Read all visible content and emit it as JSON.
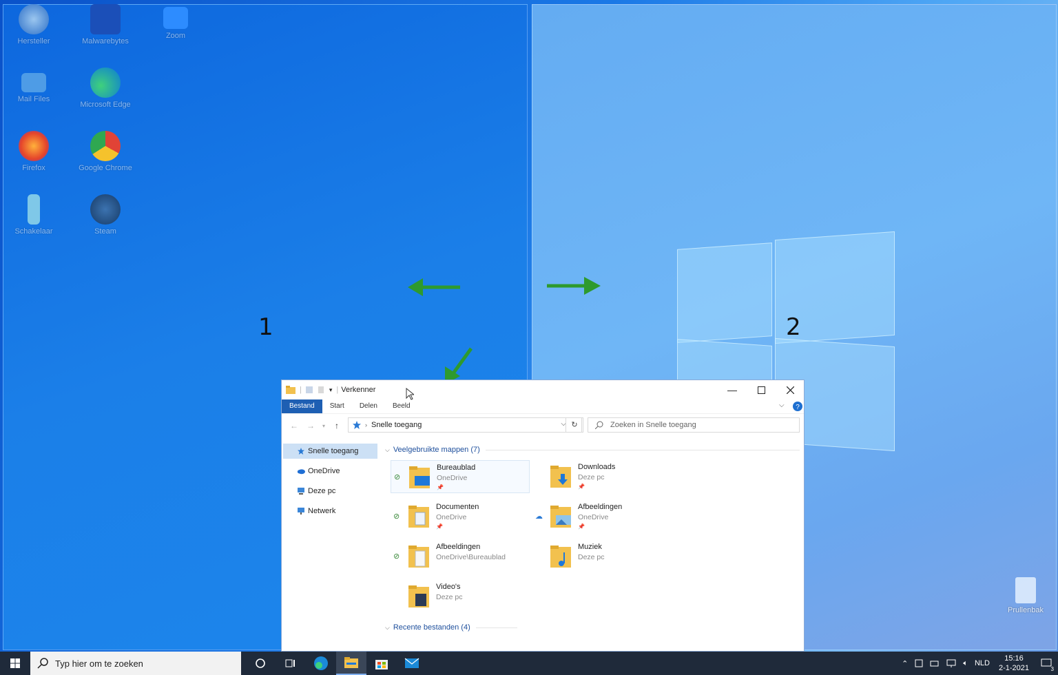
{
  "desktop": {
    "icons": [
      {
        "label": "Hersteller",
        "icon": "recovery-icon"
      },
      {
        "label": "Malwarebytes",
        "icon": "malwarebytes-icon"
      },
      {
        "label": "Zoom",
        "icon": "zoom-icon"
      },
      {
        "label": "Mail Files",
        "icon": "mail-files-icon"
      },
      {
        "label": "Microsoft Edge",
        "icon": "edge-icon"
      },
      {
        "label": "Firefox",
        "icon": "firefox-icon"
      },
      {
        "label": "Google Chrome",
        "icon": "chrome-icon"
      },
      {
        "label": "Schakelaar",
        "icon": "app-icon"
      },
      {
        "label": "Steam",
        "icon": "steam-icon"
      }
    ],
    "recycle_bin": "Prullenbak",
    "snap_labels": {
      "left": "1",
      "right": "2"
    },
    "colors": {
      "arrow": "#2e9a2e"
    }
  },
  "explorer": {
    "title": "Verkenner",
    "ribbon_tabs": [
      "Bestand",
      "Start",
      "Delen",
      "Beeld"
    ],
    "address": "Snelle toegang",
    "search_placeholder": "Zoeken in Snelle toegang",
    "sidebar": [
      "Snelle toegang",
      "OneDrive",
      "Deze pc",
      "Netwerk"
    ],
    "frequent_header": "Veelgebruikte mappen (7)",
    "recent_header": "Recente bestanden (4)",
    "folders": [
      {
        "name": "Bureaublad",
        "sub": "OneDrive",
        "pinned": true,
        "status": "synced"
      },
      {
        "name": "Downloads",
        "sub": "Deze pc",
        "pinned": true,
        "status": ""
      },
      {
        "name": "Documenten",
        "sub": "OneDrive",
        "pinned": true,
        "status": "synced"
      },
      {
        "name": "Afbeeldingen",
        "sub": "OneDrive",
        "pinned": true,
        "status": "cloud"
      },
      {
        "name": "Afbeeldingen",
        "sub": "OneDrive\\Bureaublad",
        "pinned": false,
        "status": "synced"
      },
      {
        "name": "Muziek",
        "sub": "Deze pc",
        "pinned": false,
        "status": ""
      },
      {
        "name": "Video's",
        "sub": "Deze pc",
        "pinned": false,
        "status": ""
      }
    ]
  },
  "taskbar": {
    "search_placeholder": "Typ hier om te zoeken",
    "language": "NLD",
    "time": "15:16",
    "date": "2-1-2021",
    "notifications": "3"
  }
}
